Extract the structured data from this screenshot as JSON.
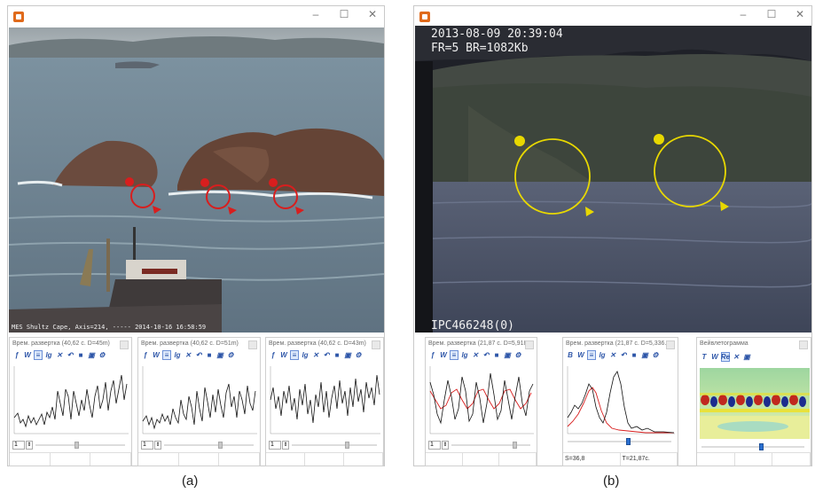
{
  "left_window": {
    "overlay_text": "MES Shultz Cape, Axis=214, ----- 2014-10-16 16:58:59",
    "window_buttons": [
      "–",
      "☐",
      "✕"
    ],
    "panels": [
      {
        "title": "Врем. развертка (40,62 с. D=45m)",
        "spin_value": "1"
      },
      {
        "title": "Врем. развертка (40,62 с. D=51m)",
        "spin_value": "1"
      },
      {
        "title": "Врем. развертка (40,62 с. D=43m)",
        "spin_value": "1"
      }
    ]
  },
  "right_window": {
    "overlay_line1": "2013-08-09 20:39:04",
    "overlay_line2": "FR=5 BR=1082Kb",
    "overlay_bottom": "IPC466248(0)",
    "window_buttons": [
      "–",
      "☐",
      "✕"
    ],
    "panels": [
      {
        "title": "Врем. развертка (21,87 с. D=5,918...",
        "spin_value": "1"
      },
      {
        "title": "Врем. развертка (21,87 с. D=5,336...",
        "spin_value": "1",
        "status_left": "S=36,8",
        "status_right": "T=21,87c."
      },
      {
        "title": "Вейвлетограмма"
      }
    ]
  },
  "toolbar_icons": [
    "signal-f-icon",
    "wave-w-icon",
    "filter-icon",
    "log-icon",
    "tools-icon",
    "undo-icon",
    "stop-icon",
    "save-icon",
    "settings-icon"
  ],
  "captions": {
    "a": "(a)",
    "b": "(b)"
  },
  "colors": {
    "marker_red": "#d81e1e",
    "marker_yellow": "#e8d800",
    "accent_blue": "#2a6fd0"
  }
}
